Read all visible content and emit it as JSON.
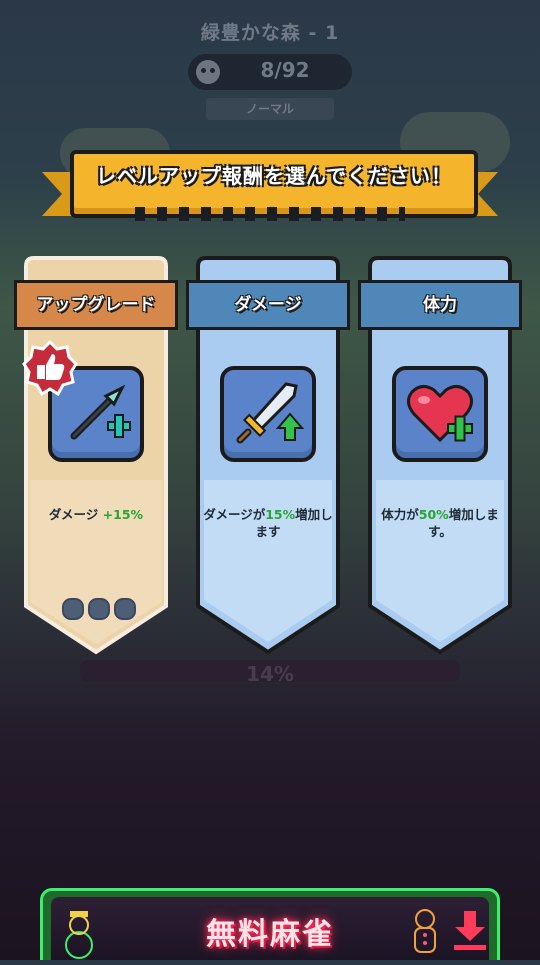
{
  "header": {
    "stage_title": "緑豊かな森 - 1",
    "kill_progress": "8/92",
    "difficulty": "ノーマル"
  },
  "banner": {
    "title": "レベルアップ報酬を選んでください！"
  },
  "cards": [
    {
      "title": "アップグレード",
      "desc_prefix": "ダメージ ",
      "desc_highlight": "+15%",
      "desc_suffix": "",
      "icon": "spear-plus-icon",
      "selected": true,
      "recommended": true,
      "level_dots": 3
    },
    {
      "title": "ダメージ",
      "desc_prefix": "ダメージが",
      "desc_highlight": "15%",
      "desc_suffix": "増加します",
      "icon": "sword-up-icon",
      "selected": false
    },
    {
      "title": "体力",
      "desc_prefix": "体力が",
      "desc_highlight": "50%",
      "desc_suffix": "増加します。",
      "icon": "heart-plus-icon",
      "selected": false
    }
  ],
  "stage_percent": "14%",
  "ad": {
    "text": "無料麻雀"
  },
  "colors": {
    "banner": "#f4b52c",
    "selected_header": "#d6884a",
    "blue_header": "#4f88b8",
    "highlight_green": "#27a533",
    "ad_glow": "#3df06a"
  }
}
